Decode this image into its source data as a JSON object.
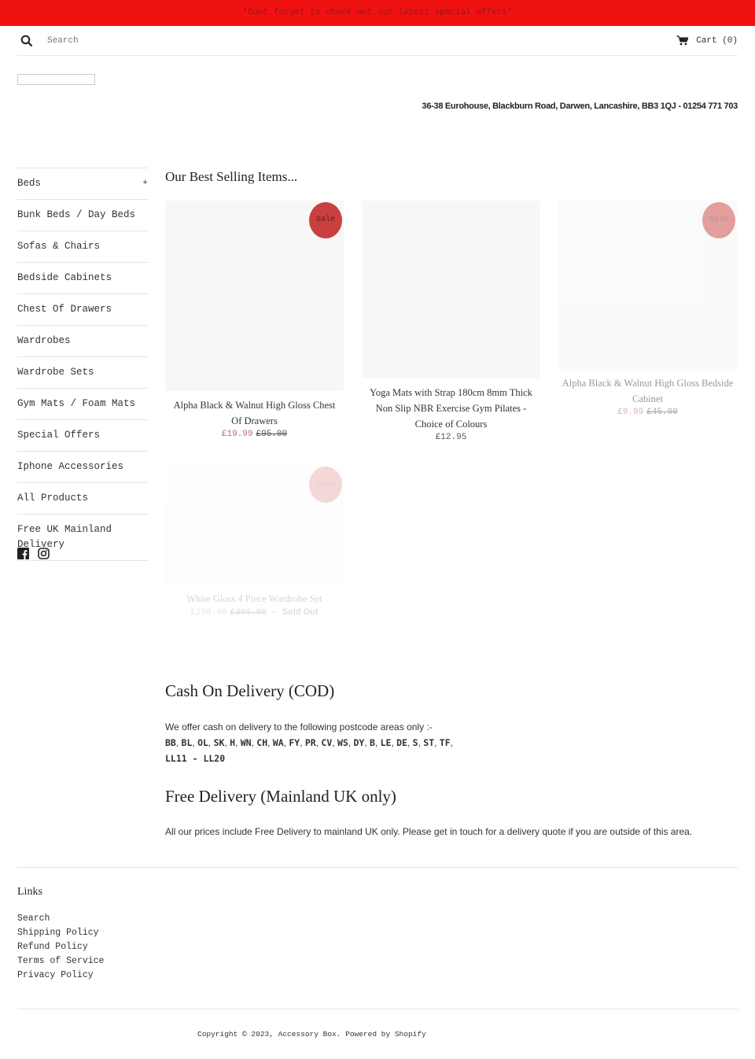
{
  "announcement": "*Dont forget to check out our latest special offers*",
  "header": {
    "search_placeholder": "Search",
    "cart_label": "Cart (0)",
    "address": "36-38 Eurohouse, Blackburn Road, Darwen, Lancashire, BB3 1QJ - 01254 771 703"
  },
  "sidebar": {
    "items": [
      {
        "label": "Beds",
        "toggle": "+"
      },
      {
        "label": "Bunk Beds / Day Beds"
      },
      {
        "label": "Sofas & Chairs"
      },
      {
        "label": "Bedside Cabinets"
      },
      {
        "label": "Chest Of Drawers"
      },
      {
        "label": "Wardrobes"
      },
      {
        "label": "Wardrobe Sets"
      },
      {
        "label": "Gym Mats / Foam Mats"
      },
      {
        "label": "Special Offers"
      },
      {
        "label": "Iphone Accessories"
      },
      {
        "label": "All Products"
      },
      {
        "label": "Free UK Mainland Delivery"
      }
    ],
    "social": [
      "facebook-icon",
      "instagram-icon"
    ]
  },
  "main": {
    "title": "Our Best Selling Items...",
    "products": [
      {
        "name": "Alpha Black & Walnut High Gloss Chest Of Drawers",
        "price": "£19.99",
        "original": "£95.00",
        "badge": "Sale"
      },
      {
        "name": "Yoga Mats with Strap 180cm 8mm Thick Non Slip NBR Exercise Gym Pilates - Choice of Colours",
        "price": "£12.95"
      },
      {
        "name": "Alpha Black & Walnut High Gloss Bedside Cabinet",
        "price": "£9.99",
        "original": "£45.00",
        "badge": "Sale"
      },
      {
        "name": "White Gloss 4 Piece Wardrobe Set",
        "price": "£250.00",
        "original": "£300.00",
        "separator": "—",
        "status": "Sold Out",
        "badge": "Sale"
      }
    ]
  },
  "cod": {
    "title": "Cash On Delivery (COD)",
    "intro": "We offer cash on delivery to the following postcode areas only :-",
    "codes": [
      "BB",
      "BL",
      "OL",
      "SK",
      "H",
      "WN",
      "CH",
      "WA",
      "FY",
      "PR",
      "CV",
      "WS",
      "DY",
      "B",
      "LE",
      "DE",
      "S",
      "ST",
      "TF"
    ],
    "range": "LL11 - LL20"
  },
  "delivery": {
    "title": "Free Delivery (Mainland UK only)",
    "text": "All our prices include Free Delivery to mainland UK only. Please get in touch for a delivery quote if you are outside of this area."
  },
  "footer": {
    "links_title": "Links",
    "links": [
      "Search",
      "Shipping Policy",
      "Refund Policy",
      "Terms of Service",
      "Privacy Policy"
    ],
    "copyright": "Copyright © 2023, Accessory Box. Powered by Shopify"
  },
  "colors": {
    "announcement_bg": "#f01111",
    "sale_badge": "#c9403e",
    "sale_price": "#b86b6b"
  }
}
